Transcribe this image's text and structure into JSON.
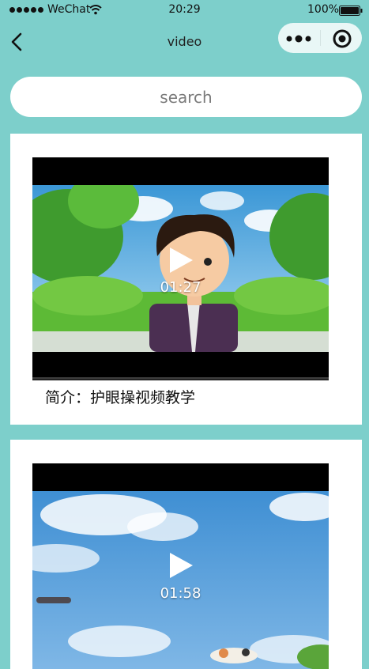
{
  "status_bar": {
    "carrier": "WeChat",
    "time": "20:29",
    "battery": "100%",
    "icons": [
      "signal-icon",
      "wifi-icon",
      "battery-icon"
    ]
  },
  "nav": {
    "title": "video",
    "icons": [
      "back-icon",
      "more-icon",
      "close-mini-icon"
    ]
  },
  "search": {
    "placeholder": "search"
  },
  "videos": [
    {
      "duration": "01:27",
      "caption": "简介：护眼操视频教学",
      "icons": [
        "play-icon"
      ]
    },
    {
      "duration": "01:58",
      "icons": [
        "play-icon"
      ]
    }
  ],
  "colors": {
    "background": "#7dcfcb",
    "card": "#ffffff",
    "capsule": "#e9f7f6"
  }
}
